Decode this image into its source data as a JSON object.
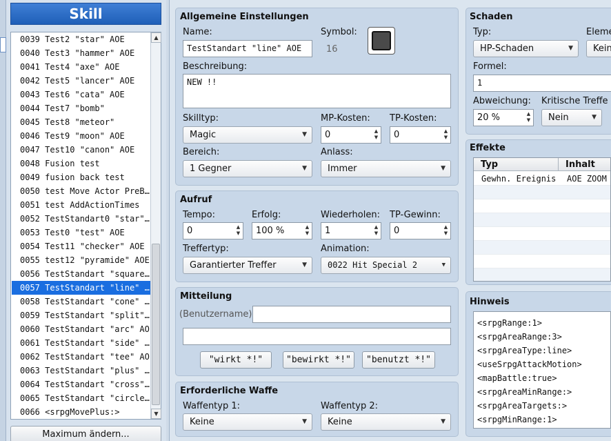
{
  "left_panel": {
    "title": "Skill",
    "items": [
      {
        "label": "0039 Test2 \"star\" AOE"
      },
      {
        "label": "0040 Test3 \"hammer\" AOE"
      },
      {
        "label": "0041 Test4 \"axe\" AOE"
      },
      {
        "label": "0042 Test5 \"lancer\" AOE"
      },
      {
        "label": "0043 Test6 \"cata\" AOE"
      },
      {
        "label": "0044 Test7 \"bomb\""
      },
      {
        "label": "0045 Test8 \"meteor\""
      },
      {
        "label": "0046 Test9 \"moon\" AOE"
      },
      {
        "label": "0047 Test10 \"canon\"  AOE"
      },
      {
        "label": "0048 Fusion test"
      },
      {
        "label": "0049 fusion back test"
      },
      {
        "label": "0050 test Move Actor PreB…"
      },
      {
        "label": "0051 test AddActionTimes"
      },
      {
        "label": "0052 TestStandart0 \"star\"…"
      },
      {
        "label": "0053 Test0 \"test\" AOE"
      },
      {
        "label": "0054 Test11 \"checker\" AOE"
      },
      {
        "label": "0055 test12 \"pyramide\" AOE"
      },
      {
        "label": "0056 TestStandart \"square…"
      },
      {
        "label": "0057 TestStandart \"line\" …"
      },
      {
        "label": "0058 TestStandart \"cone\" …"
      },
      {
        "label": "0059 TestStandart \"split\"…"
      },
      {
        "label": "0060 TestStandart \"arc\" AOE"
      },
      {
        "label": "0061 TestStandart \"side\" …"
      },
      {
        "label": "0062 TestStandart \"tee\" AOE"
      },
      {
        "label": "0063 TestStandart \"plus\" …"
      },
      {
        "label": "0064 TestStandart \"cross\"…"
      },
      {
        "label": "0065 TestStandart \"circle…"
      },
      {
        "label": "0066 <srpgMovePlus:>"
      }
    ],
    "selected_label": "0057 TestStandart \"line\" …",
    "max_button": "Maximum ändern..."
  },
  "general": {
    "title": "Allgemeine Einstellungen",
    "name_label": "Name:",
    "name_value": "TestStandart \"line\" AOE",
    "symbol_label": "Symbol:",
    "symbol_value": "16",
    "desc_label": "Beschreibung:",
    "desc_value": "NEW !!",
    "skilltype_label": "Skilltyp:",
    "skilltype_value": "Magic",
    "mp_label": "MP-Kosten:",
    "mp_value": "0",
    "tp_label": "TP-Kosten:",
    "tp_value": "0",
    "scope_label": "Bereich:",
    "scope_value": "1 Gegner",
    "occasion_label": "Anlass:",
    "occasion_value": "Immer"
  },
  "invocation": {
    "title": "Aufruf",
    "speed_label": "Tempo:",
    "speed_value": "0",
    "success_label": "Erfolg:",
    "success_value": "100 %",
    "repeat_label": "Wiederholen:",
    "repeat_value": "1",
    "tpgain_label": "TP-Gewinn:",
    "tpgain_value": "0",
    "hittype_label": "Treffertyp:",
    "hittype_value": "Garantierter Treffer",
    "animation_label": "Animation:",
    "animation_value": "0022 Hit Special 2"
  },
  "message": {
    "title": "Mitteilung",
    "user_label": "(Benutzername)",
    "line1_value": "",
    "line2_value": "",
    "btn1": "\"wirkt *!\"",
    "btn2": "\"bewirkt *!\"",
    "btn3": "\"benutzt *!\""
  },
  "weapon": {
    "title": "Erforderliche Waffe",
    "type1_label": "Waffentyp 1:",
    "type1_value": "Keine",
    "type2_label": "Waffentyp 2:",
    "type2_value": "Keine"
  },
  "damage": {
    "title": "Schaden",
    "type_label": "Typ:",
    "type_value": "HP-Schaden",
    "element_label": "Eleme",
    "element_value": "Kein",
    "formula_label": "Formel:",
    "formula_value": "1",
    "variance_label": "Abweichung:",
    "variance_value": "20 %",
    "critical_label": "Kritische Treffe",
    "critical_value": "Nein"
  },
  "effects": {
    "title": "Effekte",
    "col_type": "Typ",
    "col_content": "Inhalt",
    "rows": [
      {
        "type": "Gewhn. Ereignis",
        "content": "AOE ZOOM C"
      }
    ]
  },
  "note": {
    "title": "Hinweis",
    "lines": [
      "<srpgRange:1>",
      "<srpgAreaRange:3>",
      "<srpgAreaType:line>",
      "<useSrpgAttackMotion>",
      "<mapBattle:true>",
      "<srpgAreaMinRange:>",
      "<srpgAreaTargets:>",
      "<srpgMinRange:1>"
    ]
  },
  "icons": {
    "dropdown": "chevron-down-icon",
    "spinner": "spinner-arrows-icon",
    "scroll_up": "scroll-up-arrow-icon",
    "scroll_down": "scroll-down-arrow-icon",
    "symbol": "skill-symbol-icon"
  },
  "colors": {
    "header_blue": "#1f5fb8",
    "selection": "#1a6ee0",
    "panel": "#c8d7e8"
  }
}
